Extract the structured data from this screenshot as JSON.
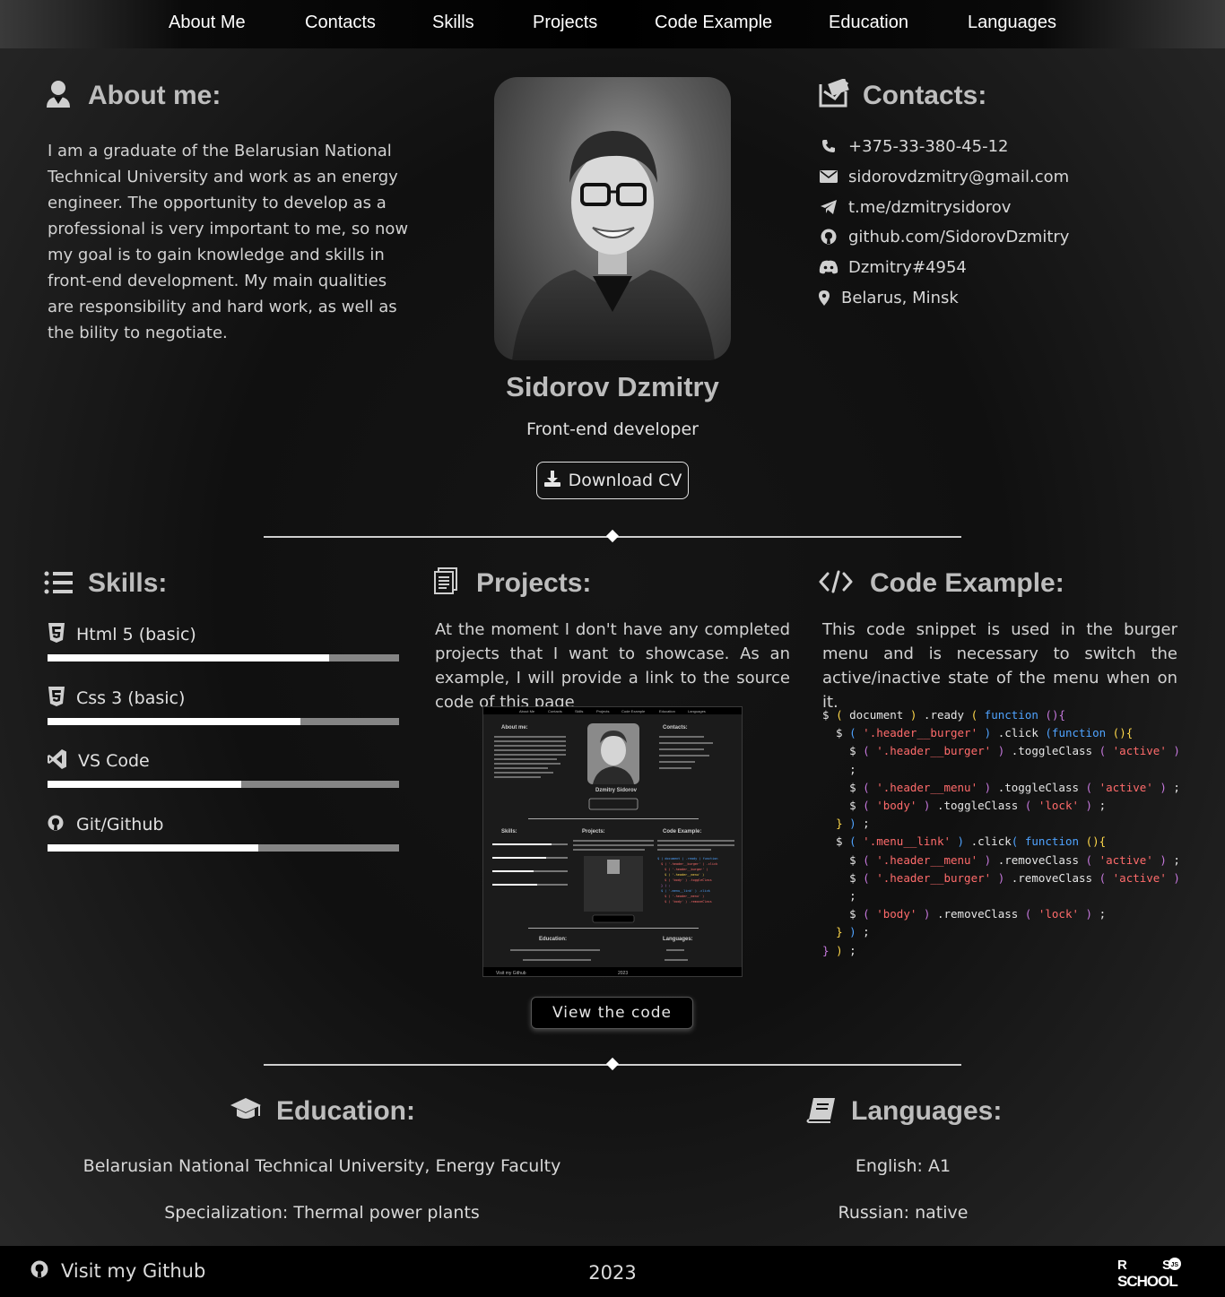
{
  "nav": {
    "items": [
      "About Me",
      "Contacts",
      "Skills",
      "Projects",
      "Code Example",
      "Education",
      "Languages"
    ]
  },
  "about": {
    "title": "About me:",
    "text": "I am a graduate of the Belarusian National Technical University and work as an energy engineer. The opportunity to develop as a professional is very important to me, so now my goal is to gain knowledge and skills in front-end development. My main qualities are responsibility and hard work, as well as the bility to negotiate."
  },
  "profile": {
    "name": "Sidorov Dzmitry",
    "role": "Front-end developer",
    "download_label": "Download CV"
  },
  "contacts": {
    "title": "Contacts:",
    "items": [
      {
        "icon": "phone-icon",
        "text": "+375-33-380-45-12"
      },
      {
        "icon": "envelope-icon",
        "text": "sidorovdzmitry@gmail.com"
      },
      {
        "icon": "telegram-icon",
        "text": "t.me/dzmitrysidorov"
      },
      {
        "icon": "github-icon",
        "text": "github.com/SidorovDzmitry"
      },
      {
        "icon": "discord-icon",
        "text": "Dzmitry#4954"
      },
      {
        "icon": "location-pin-icon",
        "text": "Belarus, Minsk"
      }
    ]
  },
  "skills": {
    "title": "Skills:",
    "items": [
      {
        "icon": "html5-icon",
        "label": "Html 5 (basic)",
        "level": 0.8
      },
      {
        "icon": "css3-icon",
        "label": "Css 3 (basic)",
        "level": 0.72
      },
      {
        "icon": "vscode-icon",
        "label": "VS Code",
        "level": 0.55
      },
      {
        "icon": "github-icon",
        "label": "Git/Github",
        "level": 0.6
      }
    ]
  },
  "projects": {
    "title": "Projects:",
    "text": "At the moment I don't have any completed projects that I want to showcase. As an example, I will provide a link to the source code of this page",
    "view_label": "View the code"
  },
  "code_example": {
    "title": "Code Example:",
    "text": "This code snippet is used in the burger menu and is necessary to switch the active/inactive state of the menu when on it."
  },
  "education": {
    "title": "Education:",
    "lines": [
      "Belarusian National Technical University, Energy Faculty",
      "Specialization: Thermal power plants"
    ]
  },
  "languages": {
    "title": "Languages:",
    "lines": [
      "English: A1",
      "Russian: native"
    ]
  },
  "footer": {
    "github_label": "Visit my Github",
    "year": "2023",
    "logo_text": "RS SCHOOL"
  },
  "colors": {
    "accent_keyword": "#4fa3ff",
    "accent_string": "#ff6b6b",
    "bracket_yellow": "#ffd84a",
    "bracket_purple": "#c678dd",
    "heading": "#bdbdbd"
  }
}
